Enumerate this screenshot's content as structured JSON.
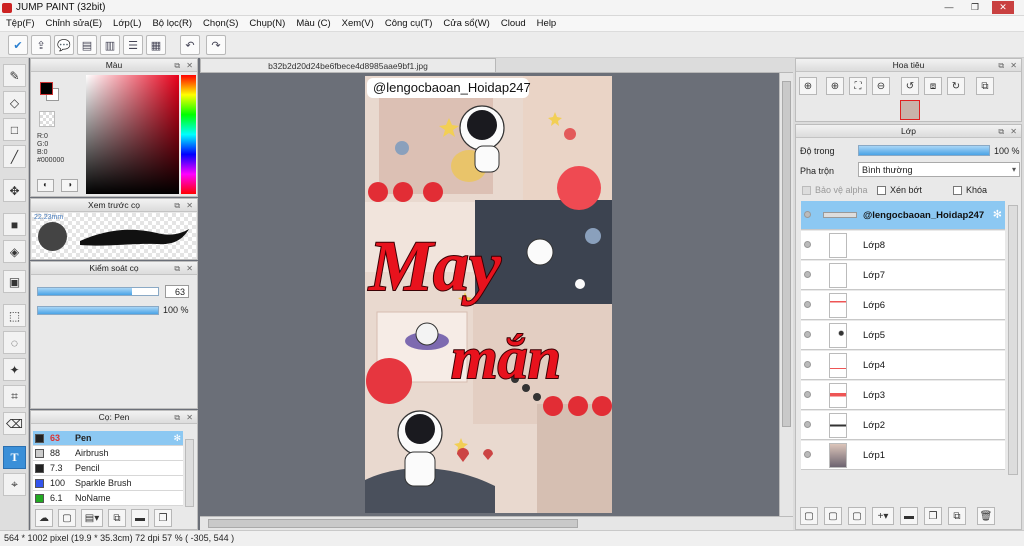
{
  "app": {
    "title": "JUMP PAINT (32bit)"
  },
  "window": {
    "minimize": "—",
    "restore": "❐",
    "close": "✕"
  },
  "menu": [
    "Tệp(F)",
    "Chỉnh sửa(E)",
    "Lớp(L)",
    "Bộ lọc(R)",
    "Chọn(S)",
    "Chụp(N)",
    "Màu (C)",
    "Xem(V)",
    "Công cụ(T)",
    "Cửa sổ(W)",
    "Cloud",
    "Help"
  ],
  "document": {
    "tab": "b32b2d20d24be6fbece4d8985aae9bf1.jpg"
  },
  "color_panel": {
    "title": "Màu",
    "rgb": [
      "R:0",
      "G:0",
      "B:0"
    ],
    "hex": "#000000",
    "primary": "#000000",
    "secondary": "#ffffff"
  },
  "brush_preview": {
    "title": "Xem trước cọ",
    "size": "22.23mm"
  },
  "brush_control": {
    "title": "Kiểm soát cọ",
    "size_value": "63",
    "size_fraction": 0.78,
    "opacity_value": "100 %",
    "opacity_fraction": 1.0
  },
  "brushes": {
    "title": "Cọ: Pen",
    "items": [
      {
        "size": "63",
        "name": "Pen",
        "color": "#222222"
      },
      {
        "size": "88",
        "name": "Airbrush",
        "color": "#cccccc"
      },
      {
        "size": "7.3",
        "name": "Pencil",
        "color": "#222222"
      },
      {
        "size": "100",
        "name": "Sparkle Brush",
        "color": "#3355ee"
      },
      {
        "size": "6.1",
        "name": "NoName",
        "color": "#22aa22"
      }
    ]
  },
  "navigator": {
    "title": "Hoa tiêu"
  },
  "layers": {
    "title": "Lớp",
    "opacity_label": "Độ trong",
    "opacity_value": "100 %",
    "opacity_fraction": 1.0,
    "blend_label": "Pha trộn",
    "blend_value": "Bình thường",
    "protect_alpha": "Bảo vệ alpha",
    "clipping": "Xén bớt",
    "lock": "Khóa",
    "items": [
      "@lengocbaoan_Hoidap247",
      "Lớp8",
      "Lớp7",
      "Lớp6",
      "Lớp5",
      "Lớp4",
      "Lớp3",
      "Lớp2",
      "Lớp1"
    ]
  },
  "artwork": {
    "watermark": "@lengocbaoan_Hoidap247",
    "word1": "May",
    "word2": "mắn"
  },
  "status": {
    "text": "564 * 1002 pixel  (19.9 * 35.3cm)  72 dpi  57 %  ( -305, 544 )"
  }
}
